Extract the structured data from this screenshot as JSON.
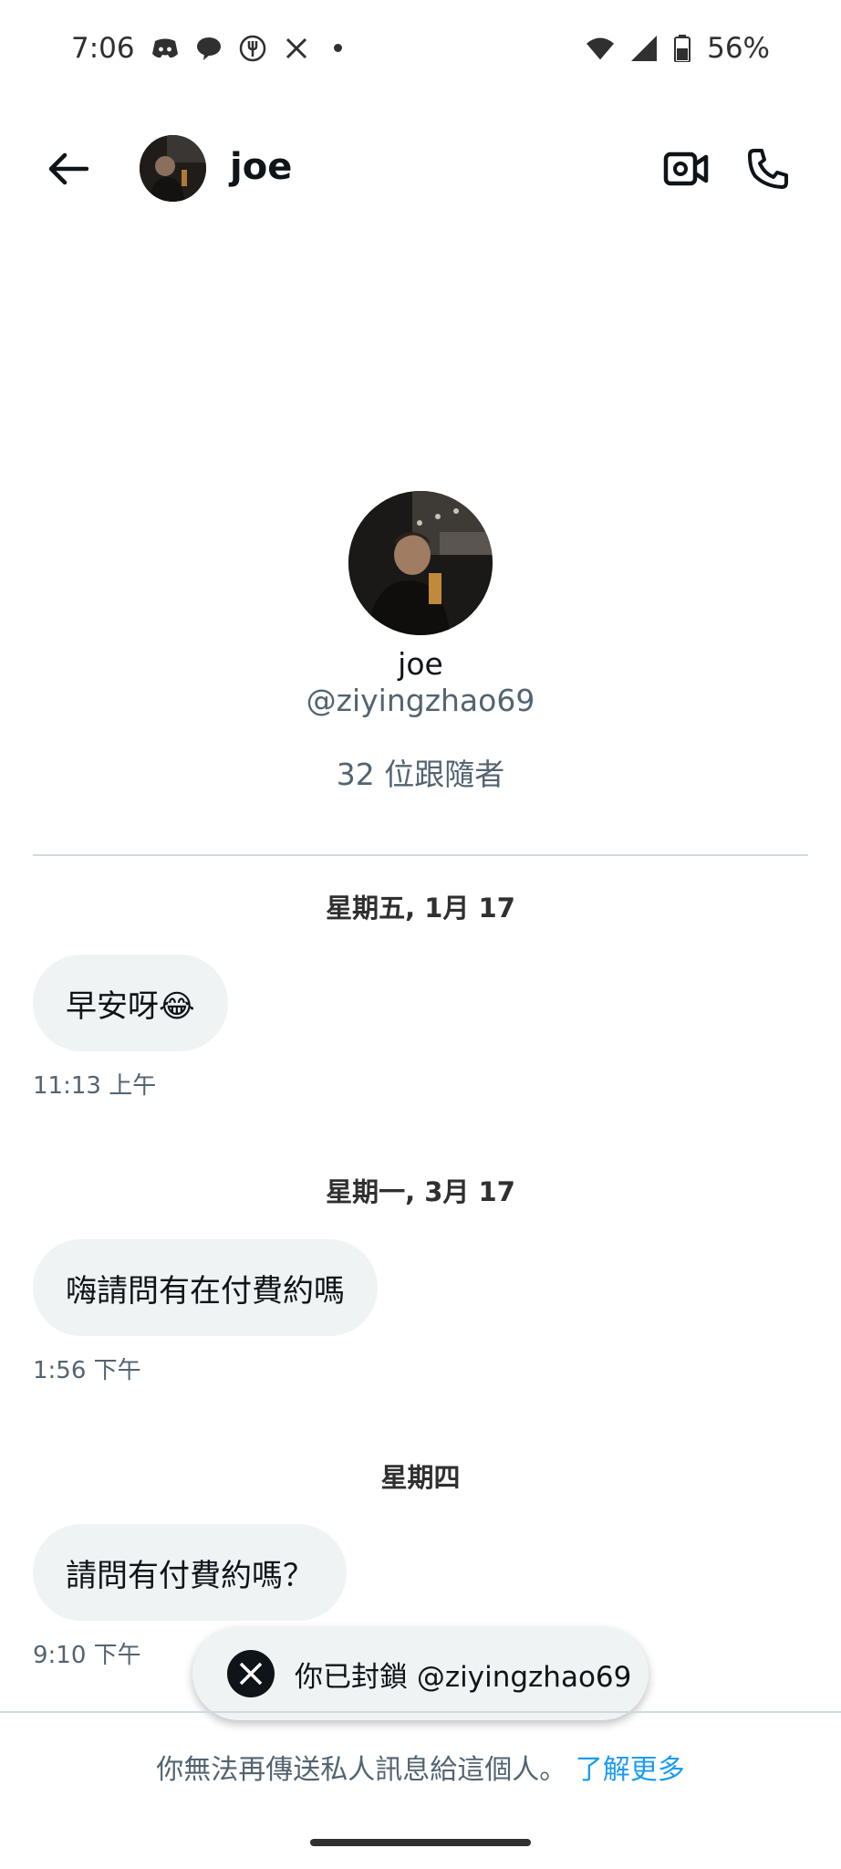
{
  "status_bar": {
    "time": "7:06",
    "battery": "56%",
    "icons": [
      "discord-icon",
      "chat-bubble-icon",
      "fork-icon",
      "x-logo-icon",
      "dot-icon",
      "wifi-icon",
      "signal-icon",
      "battery-icon"
    ]
  },
  "header": {
    "name": "joe",
    "icons": [
      "back-arrow-icon",
      "video-call-icon",
      "phone-icon"
    ]
  },
  "profile": {
    "name": "joe",
    "handle": "@ziyingzhao69",
    "followers": "32 位跟隨者"
  },
  "messages": [
    {
      "date": "星期五, 1月 17",
      "text": "早安呀😂",
      "time": "11:13 上午"
    },
    {
      "date": "星期一, 3月 17",
      "text": "嗨請問有在付費約嗎",
      "time": "1:56 下午"
    },
    {
      "date": "星期四",
      "text": "請問有付費約嗎？",
      "time": "9:10 下午"
    }
  ],
  "toast": {
    "text": "你已封鎖 @ziyingzhao69",
    "icon": "x-logo-icon"
  },
  "footer": {
    "notice": "你無法再傳送私人訊息給這個人。",
    "link": "了解更多"
  },
  "colors": {
    "accent": "#1d9bf0",
    "bubble": "#eff3f4",
    "secondary_text": "#536471"
  }
}
